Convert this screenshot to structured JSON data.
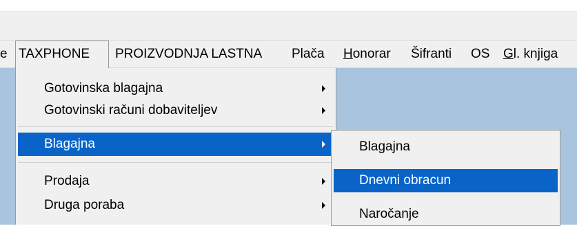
{
  "menubar": {
    "items": [
      {
        "label": "e",
        "mnemonic_prefix": "",
        "mnemonic": "",
        "rest": ""
      },
      {
        "label": "TAXPHONE"
      },
      {
        "label": "PROIZVODNJA LASTNA"
      },
      {
        "label": "Plača"
      },
      {
        "mnemonic": "H",
        "rest": "onorar"
      },
      {
        "label": "Šifranti"
      },
      {
        "label": "OS"
      },
      {
        "mnemonic": "G",
        "rest": "l. knjiga"
      }
    ]
  },
  "dropdown": {
    "items": [
      {
        "label": "Gotovinska blagajna",
        "has_submenu": true
      },
      {
        "label": "Gotovinski računi dobaviteljev",
        "has_submenu": true
      },
      {
        "label": "Blagajna",
        "has_submenu": true,
        "highlighted": true
      },
      {
        "label": "Prodaja",
        "has_submenu": true
      },
      {
        "label": "Druga poraba",
        "has_submenu": true
      }
    ]
  },
  "submenu": {
    "items": [
      {
        "label": "Blagajna"
      },
      {
        "label": "Dnevni obracun",
        "highlighted": true
      },
      {
        "label": "Naročanje"
      }
    ]
  },
  "colors": {
    "highlight": "#0a64c8",
    "workspace": "#a9c4de",
    "menu_bg": "#f0f0f0"
  }
}
